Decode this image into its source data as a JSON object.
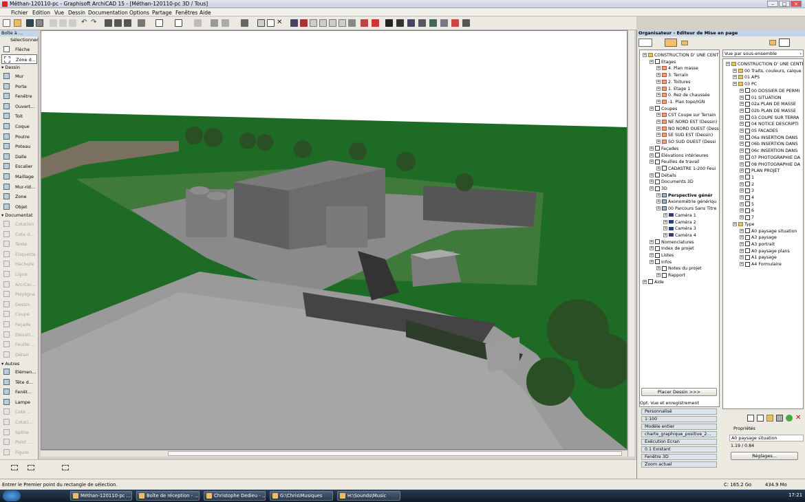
{
  "window": {
    "title": "Méthan-120110-pc - Graphisoft ArchiCAD 15 - [Méthan-120110-pc 3D / Tous]"
  },
  "menu": [
    "Fichier",
    "Edition",
    "Vue",
    "Dessin",
    "Documentation",
    "Options",
    "Partage",
    "Fenêtres",
    "Aide"
  ],
  "toolbox": {
    "title": "Boîte à ...",
    "select_label": "Sélectionner",
    "arrow": "Flèche",
    "zone": "Zone d...",
    "sections": {
      "dessin": "Dessin",
      "documentation": "Documentat",
      "autres": "Autres"
    },
    "dessin_items": [
      "Mur",
      "Porte",
      "Fenêtre",
      "Ouvert...",
      "Toit",
      "Coque",
      "Poutre",
      "Poteau",
      "Dalle",
      "Escalier",
      "Maillage",
      "Mur-rid...",
      "Zone",
      "Objet"
    ],
    "doc_items": [
      "Cotation",
      "Cote d...",
      "Texte",
      "Etiquette",
      "Hachure",
      "Ligne",
      "Arc/Cer...",
      "Polyligne",
      "Dessin",
      "Coupe",
      "Façade",
      "Elévati...",
      "Feuille ...",
      "Détail"
    ],
    "autres_items": [
      "Elémen...",
      "Tête d...",
      "Fenêt...",
      "Lampe",
      "Cote ...",
      "Cotati...",
      "Spline",
      "Point ...",
      "Figure"
    ]
  },
  "organizer": {
    "title": "Organisateur - Editeur de Mise en page",
    "dropdown": "Vue par sous-ensemble",
    "left_tree": [
      {
        "d": 0,
        "t": "CONSTRUCTION D' UNE CENTR",
        "i": "f"
      },
      {
        "d": 1,
        "t": "Etages",
        "i": "s"
      },
      {
        "d": 2,
        "t": "4. Plan masse",
        "i": "e"
      },
      {
        "d": 2,
        "t": "3. Terrain",
        "i": "e"
      },
      {
        "d": 2,
        "t": "2. Toitures",
        "i": "e"
      },
      {
        "d": 2,
        "t": "1. Etage 1",
        "i": "e"
      },
      {
        "d": 2,
        "t": "0. Rez de chaussée",
        "i": "e"
      },
      {
        "d": 2,
        "t": "-1. Plan topo/IGN",
        "i": "e"
      },
      {
        "d": 1,
        "t": "Coupes",
        "i": "s"
      },
      {
        "d": 2,
        "t": "CST Coupe sur Terrain",
        "i": "e"
      },
      {
        "d": 2,
        "t": "NE NORD EST (Dessin)",
        "i": "e"
      },
      {
        "d": 2,
        "t": "NO NORD OUEST (Dess",
        "i": "e"
      },
      {
        "d": 2,
        "t": "SE SUD EST (Dessin)",
        "i": "e"
      },
      {
        "d": 2,
        "t": "SO SUD OUEST (Dessi",
        "i": "e"
      },
      {
        "d": 1,
        "t": "Façades",
        "i": "s"
      },
      {
        "d": 1,
        "t": "Elévations intérieures",
        "i": "s"
      },
      {
        "d": 1,
        "t": "Feuilles de travail",
        "i": "s"
      },
      {
        "d": 2,
        "t": "CADASTRE 1-200 Feui",
        "i": "s"
      },
      {
        "d": 1,
        "t": "Détails",
        "i": "s"
      },
      {
        "d": 1,
        "t": "Documents 3D",
        "i": "s"
      },
      {
        "d": 1,
        "t": "3D",
        "i": "s"
      },
      {
        "d": 2,
        "t": "Perspective génér",
        "i": "p",
        "b": true
      },
      {
        "d": 2,
        "t": "Axonométrie génériqu",
        "i": "p"
      },
      {
        "d": 2,
        "t": "00 Parcours Sans Titre",
        "i": "p"
      },
      {
        "d": 3,
        "t": "Caméra 1",
        "i": "c"
      },
      {
        "d": 3,
        "t": "Caméra 2",
        "i": "c"
      },
      {
        "d": 3,
        "t": "Caméra 3",
        "i": "c"
      },
      {
        "d": 3,
        "t": "Caméra 4",
        "i": "c"
      },
      {
        "d": 1,
        "t": "Nomenclatures",
        "i": "s"
      },
      {
        "d": 1,
        "t": "Index de projet",
        "i": "s"
      },
      {
        "d": 1,
        "t": "Listes",
        "i": "s"
      },
      {
        "d": 1,
        "t": "Infos",
        "i": "s"
      },
      {
        "d": 2,
        "t": "Notes du projet",
        "i": "s"
      },
      {
        "d": 2,
        "t": "Rapport",
        "i": "s"
      },
      {
        "d": 0,
        "t": "Aide",
        "i": "s"
      }
    ],
    "right_tree": [
      {
        "d": 0,
        "t": "CONSTRUCTION D' UNE CENTR",
        "i": "f"
      },
      {
        "d": 1,
        "t": "00 Traits, couleurs, calque",
        "i": "f"
      },
      {
        "d": 1,
        "t": "01 APS",
        "i": "f"
      },
      {
        "d": 1,
        "t": "03 PC",
        "i": "f"
      },
      {
        "d": 2,
        "t": "00 DOSSIER DE PERMI",
        "i": "s"
      },
      {
        "d": 2,
        "t": "01 SITUATION",
        "i": "s"
      },
      {
        "d": 2,
        "t": "02a PLAN DE MASSE",
        "i": "s"
      },
      {
        "d": 2,
        "t": "02b PLAN DE MASSE",
        "i": "s"
      },
      {
        "d": 2,
        "t": "03 COUPE SUR TERRA",
        "i": "s"
      },
      {
        "d": 2,
        "t": "04 NOTICE DESCRIPTI",
        "i": "s"
      },
      {
        "d": 2,
        "t": "05 FACADES",
        "i": "s"
      },
      {
        "d": 2,
        "t": "06a INSERTION DANS",
        "i": "s"
      },
      {
        "d": 2,
        "t": "06b INSERTION DANS",
        "i": "s"
      },
      {
        "d": 2,
        "t": "06c INSERTION DANS",
        "i": "s"
      },
      {
        "d": 2,
        "t": "07 PHOTOGRAPHIE DA",
        "i": "s"
      },
      {
        "d": 2,
        "t": "08 PHOTOGRAPHIE DA",
        "i": "s"
      },
      {
        "d": 2,
        "t": "PLAN PROJET",
        "i": "s"
      },
      {
        "d": 2,
        "t": "1",
        "i": "s"
      },
      {
        "d": 2,
        "t": "2",
        "i": "s"
      },
      {
        "d": 2,
        "t": "3",
        "i": "s"
      },
      {
        "d": 2,
        "t": "4",
        "i": "s"
      },
      {
        "d": 2,
        "t": "5",
        "i": "s"
      },
      {
        "d": 2,
        "t": "6",
        "i": "s"
      },
      {
        "d": 2,
        "t": "7",
        "i": "s"
      },
      {
        "d": 1,
        "t": "Type",
        "i": "f"
      },
      {
        "d": 2,
        "t": "A0 paysage situation",
        "i": "s"
      },
      {
        "d": 2,
        "t": "A3 paysage",
        "i": "s"
      },
      {
        "d": 2,
        "t": "A3 portrait",
        "i": "s"
      },
      {
        "d": 2,
        "t": "A0 paysage plans",
        "i": "s"
      },
      {
        "d": 2,
        "t": "A1 paysage",
        "i": "s"
      },
      {
        "d": 2,
        "t": "A4 Formulaire",
        "i": "s"
      }
    ],
    "place_button": "Placer Dessin >>>",
    "opt_title": "Opt. Vue et enregistrement",
    "options": [
      "Personnalisé",
      "1:100",
      "Modèle entier",
      "charte_graphique_positive_2...",
      "Exécution Ecran",
      "0.1 Existant",
      "Fenêtre 3D",
      "Zoom actuel"
    ],
    "properties_label": "Propriétés",
    "prop_name": "A0 paysage situation",
    "prop_size": "1.19 / 0.84",
    "settings_button": "Réglages..."
  },
  "status": {
    "text": "Entrer le Premier point du rectangle de sélection.",
    "disk": "C: 165.2 Go",
    "mem": "434.9 Mo"
  },
  "taskbar": {
    "items": [
      "Méthan-120110-pc ...",
      "Boîte de réception - ...",
      "Christophe Dedieu - ...",
      "G:\\Chris\\Musiques",
      "H:\\Sounds\\Music"
    ],
    "time": "17:21"
  },
  "colors": {
    "grass": "#1d6b24",
    "sky": "#ffffff",
    "pavement": "#8e8e8e",
    "building": "#6c6c6c"
  }
}
